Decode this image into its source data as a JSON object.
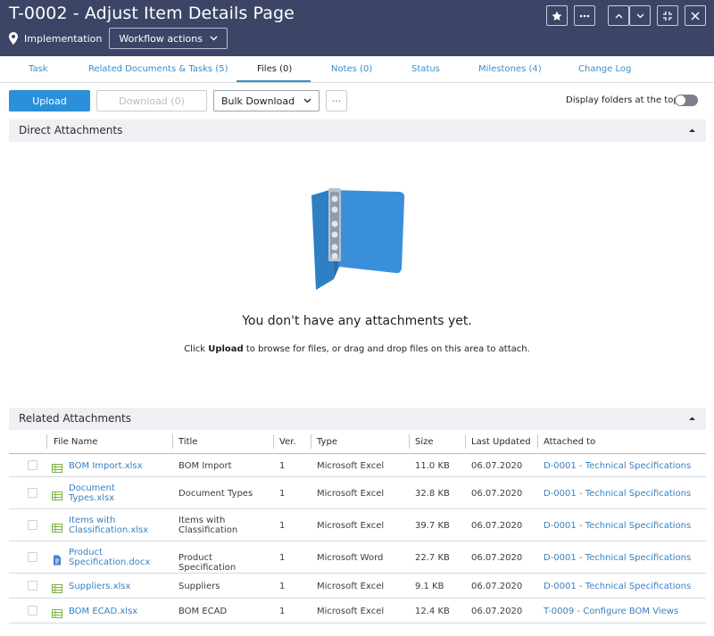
{
  "header": {
    "title": "T-0002 - Adjust Item Details Page",
    "state": "Implementation",
    "workflow_button": "Workflow actions",
    "actions": [
      "star-icon",
      "more-icon",
      "chevron-up-icon",
      "chevron-down-icon",
      "collapse-icon",
      "close-icon"
    ]
  },
  "tabs": [
    {
      "label": "Task",
      "active": false
    },
    {
      "label": "Related Documents & Tasks (5)",
      "active": false
    },
    {
      "label": "Files (0)",
      "active": true
    },
    {
      "label": "Notes (0)",
      "active": false
    },
    {
      "label": "Status",
      "active": false
    },
    {
      "label": "Milestones (4)",
      "active": false
    },
    {
      "label": "Change Log",
      "active": false
    }
  ],
  "toolbar": {
    "upload": "Upload",
    "download": "Download (0)",
    "bulk_download": "Bulk Download",
    "more": "···",
    "folders_label": "Display folders at the top",
    "folders_toggle_on": false
  },
  "direct": {
    "title": "Direct Attachments",
    "empty_title": "You don't have any attachments yet.",
    "empty_prefix": "Click",
    "empty_keyword": "Upload",
    "empty_suffix": "to browse for files, or drag and drop files on this area to attach."
  },
  "related": {
    "title": "Related Attachments",
    "columns": [
      "File Name",
      "Title",
      "Ver.",
      "Type",
      "Size",
      "Last Updated",
      "Attached to"
    ],
    "rows": [
      {
        "file": [
          "BOM Import.xlsx"
        ],
        "title": [
          "BOM Import"
        ],
        "ver": "1",
        "type": "Microsoft Excel",
        "size": "11.0 KB",
        "updated": "06.07.2020",
        "attached": "D-0001 - Technical Specifications",
        "icon": "excel-icon"
      },
      {
        "file": [
          "Document",
          "Types.xlsx"
        ],
        "title": [
          "Document Types"
        ],
        "ver": "1",
        "type": "Microsoft Excel",
        "size": "32.8 KB",
        "updated": "06.07.2020",
        "attached": "D-0001 - Technical Specifications",
        "icon": "excel-icon"
      },
      {
        "file": [
          "Items with",
          "Classification.xlsx"
        ],
        "title": [
          "Items with",
          "Classification"
        ],
        "ver": "1",
        "type": "Microsoft Excel",
        "size": "39.7 KB",
        "updated": "06.07.2020",
        "attached": "D-0001 - Technical Specifications",
        "icon": "excel-icon"
      },
      {
        "file": [
          "Product",
          "Specification.docx"
        ],
        "title": [
          "Product Specification"
        ],
        "ver": "1",
        "type": "Microsoft Word",
        "size": "22.7 KB",
        "updated": "06.07.2020",
        "attached": "D-0001 - Technical Specifications",
        "icon": "word-icon"
      },
      {
        "file": [
          "Suppliers.xlsx"
        ],
        "title": [
          "Suppliers"
        ],
        "ver": "1",
        "type": "Microsoft Excel",
        "size": "9.1 KB",
        "updated": "06.07.2020",
        "attached": "D-0001 - Technical Specifications",
        "icon": "excel-icon"
      },
      {
        "file": [
          "BOM ECAD.xlsx"
        ],
        "title": [
          "BOM ECAD"
        ],
        "ver": "1",
        "type": "Microsoft Excel",
        "size": "12.4 KB",
        "updated": "06.07.2020",
        "attached": "T-0009 - Configure BOM Views",
        "icon": "excel-icon"
      }
    ]
  },
  "colors": {
    "header_bg": "#3c4565",
    "accent": "#2b90d9",
    "link": "#3a7fbf",
    "excel_icon": "#7cb342",
    "word_icon": "#3f7fd6"
  }
}
